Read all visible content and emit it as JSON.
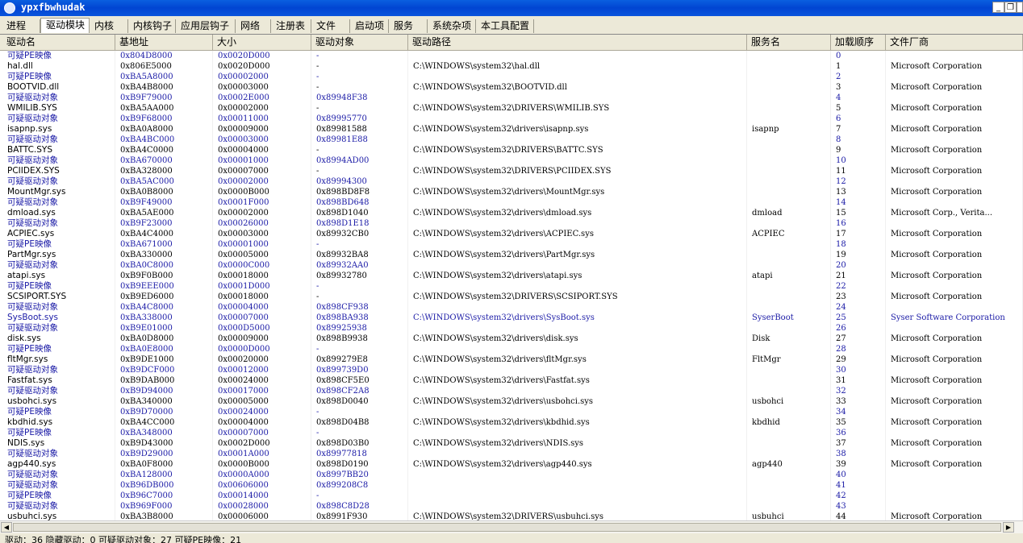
{
  "window": {
    "title": "ypxfbwhudak",
    "minimize": "_",
    "restore": "❐",
    "close": "✕"
  },
  "tabs": [
    "进程",
    "驱动模块",
    "内核",
    "内核钩子",
    "应用层钩子",
    "网络",
    "注册表",
    "文件",
    "启动项",
    "服务",
    "系统杂项",
    "本工具配置"
  ],
  "active_tab": 1,
  "columns": [
    "驱动名",
    "基地址",
    "大小",
    "驱动对象",
    "驱动路径",
    "服务名",
    "加载顺序",
    "文件厂商"
  ],
  "rows": [
    [
      "可疑PE映像",
      "0x804D8000",
      "0x0020D000",
      "-",
      "",
      "",
      "0",
      ""
    ],
    [
      "hal.dll",
      "0x806E5000",
      "0x0020D000",
      "-",
      "C:\\WINDOWS\\system32\\hal.dll",
      "",
      "1",
      "Microsoft Corporation"
    ],
    [
      "可疑PE映像",
      "0xBA5A8000",
      "0x00002000",
      "-",
      "",
      "",
      "2",
      ""
    ],
    [
      "BOOTVID.dll",
      "0xBA4B8000",
      "0x00003000",
      "-",
      "C:\\WINDOWS\\system32\\BOOTVID.dll",
      "",
      "3",
      "Microsoft Corporation"
    ],
    [
      "可疑驱动对象",
      "0xB9F79000",
      "0x0002E000",
      "0x89948F38",
      "",
      "",
      "4",
      ""
    ],
    [
      "WMILIB.SYS",
      "0xBA5AA000",
      "0x00002000",
      "-",
      "C:\\WINDOWS\\system32\\DRIVERS\\WMILIB.SYS",
      "",
      "5",
      "Microsoft Corporation"
    ],
    [
      "可疑驱动对象",
      "0xB9F68000",
      "0x00011000",
      "0x89995770",
      "",
      "",
      "6",
      ""
    ],
    [
      "isapnp.sys",
      "0xBA0A8000",
      "0x00009000",
      "0x89981588",
      "C:\\WINDOWS\\system32\\drivers\\isapnp.sys",
      "isapnp",
      "7",
      "Microsoft Corporation"
    ],
    [
      "可疑驱动对象",
      "0xBA4BC000",
      "0x00003000",
      "0x89981E88",
      "",
      "",
      "8",
      ""
    ],
    [
      "BATTC.SYS",
      "0xBA4C0000",
      "0x00004000",
      "-",
      "C:\\WINDOWS\\system32\\DRIVERS\\BATTC.SYS",
      "",
      "9",
      "Microsoft Corporation"
    ],
    [
      "可疑驱动对象",
      "0xBA670000",
      "0x00001000",
      "0x8994AD00",
      "",
      "",
      "10",
      ""
    ],
    [
      "PCIIDEX.SYS",
      "0xBA328000",
      "0x00007000",
      "-",
      "C:\\WINDOWS\\system32\\DRIVERS\\PCIIDEX.SYS",
      "",
      "11",
      "Microsoft Corporation"
    ],
    [
      "可疑驱动对象",
      "0xBA5AC000",
      "0x00002000",
      "0x89994300",
      "",
      "",
      "12",
      ""
    ],
    [
      "MountMgr.sys",
      "0xBA0B8000",
      "0x0000B000",
      "0x898BD8F8",
      "C:\\WINDOWS\\system32\\drivers\\MountMgr.sys",
      "",
      "13",
      "Microsoft Corporation"
    ],
    [
      "可疑驱动对象",
      "0xB9F49000",
      "0x0001F000",
      "0x898BD648",
      "",
      "",
      "14",
      ""
    ],
    [
      "dmload.sys",
      "0xBA5AE000",
      "0x00002000",
      "0x898D1040",
      "C:\\WINDOWS\\system32\\drivers\\dmload.sys",
      "dmload",
      "15",
      "Microsoft Corp., Verita..."
    ],
    [
      "可疑驱动对象",
      "0xB9F23000",
      "0x00026000",
      "0x898D1E18",
      "",
      "",
      "16",
      ""
    ],
    [
      "ACPIEC.sys",
      "0xBA4C4000",
      "0x00003000",
      "0x89932CB0",
      "C:\\WINDOWS\\system32\\drivers\\ACPIEC.sys",
      "ACPIEC",
      "17",
      "Microsoft Corporation"
    ],
    [
      "可疑PE映像",
      "0xBA671000",
      "0x00001000",
      "-",
      "",
      "",
      "18",
      ""
    ],
    [
      "PartMgr.sys",
      "0xBA330000",
      "0x00005000",
      "0x89932BA8",
      "C:\\WINDOWS\\system32\\drivers\\PartMgr.sys",
      "",
      "19",
      "Microsoft Corporation"
    ],
    [
      "可疑驱动对象",
      "0xBA0C8000",
      "0x0000C000",
      "0x89932AA0",
      "",
      "",
      "20",
      ""
    ],
    [
      "atapi.sys",
      "0xB9F0B000",
      "0x00018000",
      "0x89932780",
      "C:\\WINDOWS\\system32\\drivers\\atapi.sys",
      "atapi",
      "21",
      "Microsoft Corporation"
    ],
    [
      "可疑PE映像",
      "0xB9EEE000",
      "0x0001D000",
      "-",
      "",
      "",
      "22",
      ""
    ],
    [
      "SCSIPORT.SYS",
      "0xB9ED6000",
      "0x00018000",
      "-",
      "C:\\WINDOWS\\system32\\DRIVERS\\SCSIPORT.SYS",
      "",
      "23",
      "Microsoft Corporation"
    ],
    [
      "可疑驱动对象",
      "0xBA4C8000",
      "0x00004000",
      "0x898CF938",
      "",
      "",
      "24",
      ""
    ],
    [
      "SysBoot.sys",
      "0xBA338000",
      "0x00007000",
      "0x898BA938",
      "C:\\WINDOWS\\system32\\drivers\\SysBoot.sys",
      "SyserBoot",
      "25",
      "Syser Software Corporation"
    ],
    [
      "可疑驱动对象",
      "0xB9E01000",
      "0x000D5000",
      "0x89925938",
      "",
      "",
      "26",
      ""
    ],
    [
      "disk.sys",
      "0xBA0D8000",
      "0x00009000",
      "0x898B9938",
      "C:\\WINDOWS\\system32\\drivers\\disk.sys",
      "Disk",
      "27",
      "Microsoft Corporation"
    ],
    [
      "可疑PE映像",
      "0xBA0E8000",
      "0x0000D000",
      "-",
      "",
      "",
      "28",
      ""
    ],
    [
      "fltMgr.sys",
      "0xB9DE1000",
      "0x00020000",
      "0x899279E8",
      "C:\\WINDOWS\\system32\\drivers\\fltMgr.sys",
      "FltMgr",
      "29",
      "Microsoft Corporation"
    ],
    [
      "可疑驱动对象",
      "0xB9DCF000",
      "0x00012000",
      "0x899739D0",
      "",
      "",
      "30",
      ""
    ],
    [
      "Fastfat.sys",
      "0xB9DAB000",
      "0x00024000",
      "0x898CF5E0",
      "C:\\WINDOWS\\system32\\drivers\\Fastfat.sys",
      "",
      "31",
      "Microsoft Corporation"
    ],
    [
      "可疑驱动对象",
      "0xB9D94000",
      "0x00017000",
      "0x898CF2A8",
      "",
      "",
      "32",
      ""
    ],
    [
      "usbohci.sys",
      "0xBA340000",
      "0x00005000",
      "0x898D0040",
      "C:\\WINDOWS\\system32\\drivers\\usbohci.sys",
      "usbohci",
      "33",
      "Microsoft Corporation"
    ],
    [
      "可疑PE映像",
      "0xB9D70000",
      "0x00024000",
      "-",
      "",
      "",
      "34",
      ""
    ],
    [
      "kbdhid.sys",
      "0xBA4CC000",
      "0x00004000",
      "0x898D04B8",
      "C:\\WINDOWS\\system32\\drivers\\kbdhid.sys",
      "kbdhid",
      "35",
      "Microsoft Corporation"
    ],
    [
      "可疑PE映像",
      "0xBA348000",
      "0x00007000",
      "-",
      "",
      "",
      "36",
      ""
    ],
    [
      "NDIS.sys",
      "0xB9D43000",
      "0x0002D000",
      "0x898D03B0",
      "C:\\WINDOWS\\system32\\drivers\\NDIS.sys",
      "",
      "37",
      "Microsoft Corporation"
    ],
    [
      "可疑驱动对象",
      "0xB9D29000",
      "0x0001A000",
      "0x89977818",
      "",
      "",
      "38",
      ""
    ],
    [
      "agp440.sys",
      "0xBA0F8000",
      "0x0000B000",
      "0x898D0190",
      "C:\\WINDOWS\\system32\\drivers\\agp440.sys",
      "agp440",
      "39",
      "Microsoft Corporation"
    ],
    [
      "可疑驱动对象",
      "0xBA128000",
      "0x0000A000",
      "0x8997BB20",
      "",
      "",
      "40",
      ""
    ],
    [
      "可疑驱动对象",
      "0xB96DB000",
      "0x00606000",
      "0x899208C8",
      "",
      "",
      "41",
      ""
    ],
    [
      "可疑PE映像",
      "0xB96C7000",
      "0x00014000",
      "-",
      "",
      "",
      "42",
      ""
    ],
    [
      "可疑驱动对象",
      "0xB969F000",
      "0x00028000",
      "0x898C8D28",
      "",
      "",
      "43",
      ""
    ],
    [
      "usbuhci.sys",
      "0xBA3B8000",
      "0x00006000",
      "0x8991F930",
      "C:\\WINDOWS\\system32\\DRIVERS\\usbuhci.sys",
      "usbuhci",
      "44",
      "Microsoft Corporation"
    ]
  ],
  "status": "驱动：36    隐藏驱动：0    可疑驱动对象：27    可疑PE映像：21",
  "colors": {
    "suspicious_text": "#1a1aa6",
    "normal_text": "#000000",
    "titlebar": "#0145d2"
  }
}
